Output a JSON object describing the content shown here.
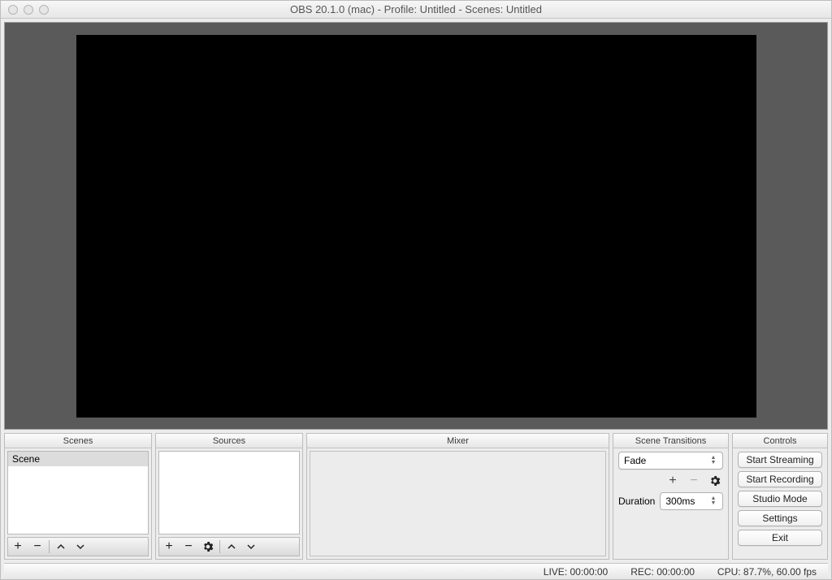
{
  "title": "OBS 20.1.0 (mac) - Profile: Untitled - Scenes: Untitled",
  "panels": {
    "scenes": {
      "header": "Scenes",
      "items": [
        "Scene"
      ]
    },
    "sources": {
      "header": "Sources"
    },
    "mixer": {
      "header": "Mixer"
    },
    "transitions": {
      "header": "Scene Transitions",
      "selected": "Fade",
      "duration_label": "Duration",
      "duration_value": "300ms"
    },
    "controls": {
      "header": "Controls",
      "buttons": {
        "start_streaming": "Start Streaming",
        "start_recording": "Start Recording",
        "studio_mode": "Studio Mode",
        "settings": "Settings",
        "exit": "Exit"
      }
    }
  },
  "statusbar": {
    "live": "LIVE: 00:00:00",
    "rec": "REC: 00:00:00",
    "cpu": "CPU: 87.7%, 60.00 fps"
  }
}
